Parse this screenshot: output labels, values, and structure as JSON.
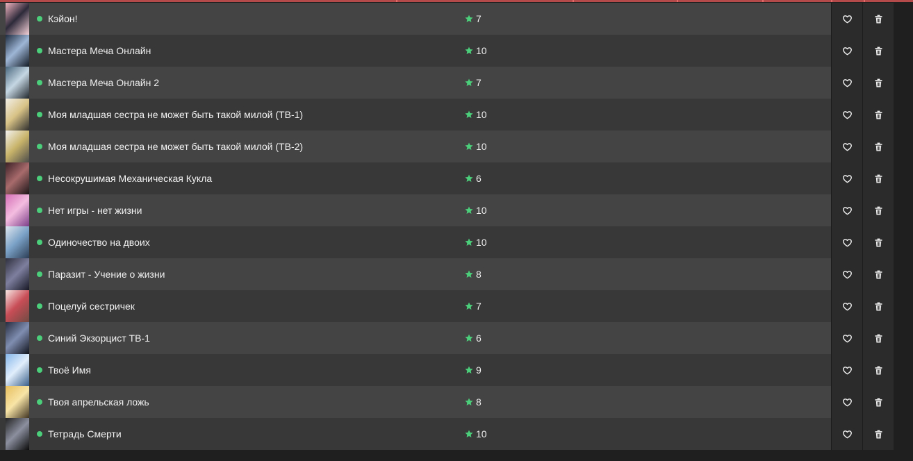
{
  "accent_color": "#4ccf7a",
  "list": {
    "items": [
      {
        "title": "Кэйон!",
        "rating": "7",
        "poster": [
          "#f1b3bf",
          "#2d2a3a",
          "#f6d1d8"
        ]
      },
      {
        "title": "Мастера Меча Онлайн",
        "rating": "10",
        "poster": [
          "#1e2c40",
          "#9eb6d6",
          "#121a25"
        ]
      },
      {
        "title": "Мастера Меча Онлайн 2",
        "rating": "7",
        "poster": [
          "#4a677e",
          "#c5d7e3",
          "#20262c"
        ]
      },
      {
        "title": "Моя младшая сестра не может быть такой милой (TB-1)",
        "rating": "10",
        "poster": [
          "#f2efe8",
          "#d8c286",
          "#2d2d2d"
        ]
      },
      {
        "title": "Моя младшая сестра не может быть такой милой (TB-2)",
        "rating": "10",
        "poster": [
          "#f3f2f0",
          "#c9b46a",
          "#4b4b4b"
        ]
      },
      {
        "title": "Несокрушимая Механическая Кукла",
        "rating": "6",
        "poster": [
          "#3a2026",
          "#a86b6c",
          "#1b1517"
        ]
      },
      {
        "title": "Нет игры - нет жизни",
        "rating": "10",
        "poster": [
          "#d56fb6",
          "#f4bde0",
          "#7a3d88"
        ]
      },
      {
        "title": "Одиночество на двоих",
        "rating": "10",
        "poster": [
          "#dfe7ef",
          "#7aa1c6",
          "#2c3d55"
        ]
      },
      {
        "title": "Паразит - Учение о жизни",
        "rating": "8",
        "poster": [
          "#2f2f3d",
          "#7d7f9e",
          "#161623"
        ]
      },
      {
        "title": "Поцелуй сестричек",
        "rating": "7",
        "poster": [
          "#f7e6e3",
          "#c84d56",
          "#6f4b43"
        ]
      },
      {
        "title": "Синий Экзорцист ТВ-1",
        "rating": "6",
        "poster": [
          "#272d3f",
          "#7f8db0",
          "#10131c"
        ]
      },
      {
        "title": "Твоё Имя",
        "rating": "9",
        "poster": [
          "#86b7ea",
          "#e1eefc",
          "#3a5e89"
        ]
      },
      {
        "title": "Твоя апрельская ложь",
        "rating": "8",
        "poster": [
          "#e7bf5f",
          "#f8e4a6",
          "#403422"
        ]
      },
      {
        "title": "Тетрадь Смерти",
        "rating": "10",
        "poster": [
          "#222222",
          "#8b8f9e",
          "#0b0b0b"
        ]
      }
    ]
  }
}
